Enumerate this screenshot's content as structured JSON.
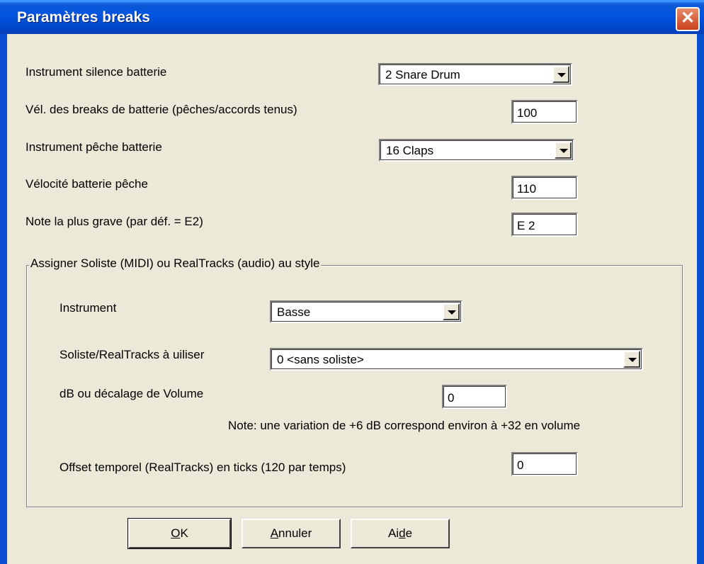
{
  "window": {
    "title": "Paramètres breaks",
    "close_glyph": "✕"
  },
  "fields": {
    "silence_instrument": {
      "label": "Instrument silence batterie",
      "value": "2 Snare Drum"
    },
    "break_velocity": {
      "label": "Vél. des breaks de batterie (pêches/accords tenus)",
      "value": "100"
    },
    "punch_instrument": {
      "label": "Instrument pêche batterie",
      "value": "16 Claps"
    },
    "punch_velocity": {
      "label": "Vélocité batterie pêche",
      "value": "110"
    },
    "lowest_note": {
      "label": "Note la plus grave (par déf. = E2)",
      "value": "E 2"
    }
  },
  "group": {
    "title": "Assigner Soliste (MIDI) ou RealTracks (audio) au style",
    "instrument": {
      "label": "Instrument",
      "value": "Basse"
    },
    "soloist": {
      "label": "Soliste/RealTracks à uiliser",
      "value": "0 <sans soliste>"
    },
    "volume": {
      "label": "dB ou décalage de Volume",
      "value": "0"
    },
    "note": "Note: une variation de +6 dB correspond environ à +32 en volume",
    "offset": {
      "label": "Offset temporel (RealTracks) en ticks (120 par temps)",
      "value": "0"
    }
  },
  "buttons": {
    "ok": {
      "u": "O",
      "rest": "K"
    },
    "cancel": {
      "u": "A",
      "rest": "nnuler"
    },
    "help": {
      "pre": "Ai",
      "u": "d",
      "rest": "e"
    }
  },
  "icons": {
    "dropdown": "chevron-down-icon",
    "close": "close-icon"
  },
  "colors": {
    "titlebar": "#0053e1",
    "face": "#ece9d8",
    "close": "#c8411d"
  }
}
